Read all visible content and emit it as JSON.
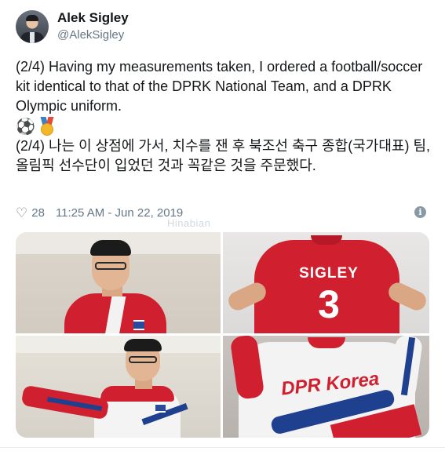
{
  "tweet": {
    "author_name": "Alek Sigley",
    "author_handle": "@AlekSigley",
    "paragraph_en": "(2/4) Having my measurements taken, I ordered a football/soccer kit identical to that of the DPRK National Team, and a DPRK Olympic uniform.",
    "emoji_ball": "⚽",
    "emoji_medal": "medal-icon",
    "paragraph_ko": "(2/4) 나는 이 상점에 가서, 치수를 잰 후 북조선 축구 종합(국가대표) 팀, 올림픽 선수단이 입었던 것과 꼭같은 것을 주문했다.",
    "heart_glyph": "♡",
    "like_count": "28",
    "timestamp": "11:25 AM - Jun 22, 2019",
    "info_glyph": "i"
  },
  "watermark": "Hinabian",
  "photos": {
    "jersey_name": "SIGLEY",
    "jersey_number": "3",
    "jacket_text": "DPR Korea"
  },
  "colors": {
    "text": "#14171a",
    "secondary": "#657786",
    "jersey_red": "#d0202f",
    "jacket_blue": "#1f3f8f"
  }
}
